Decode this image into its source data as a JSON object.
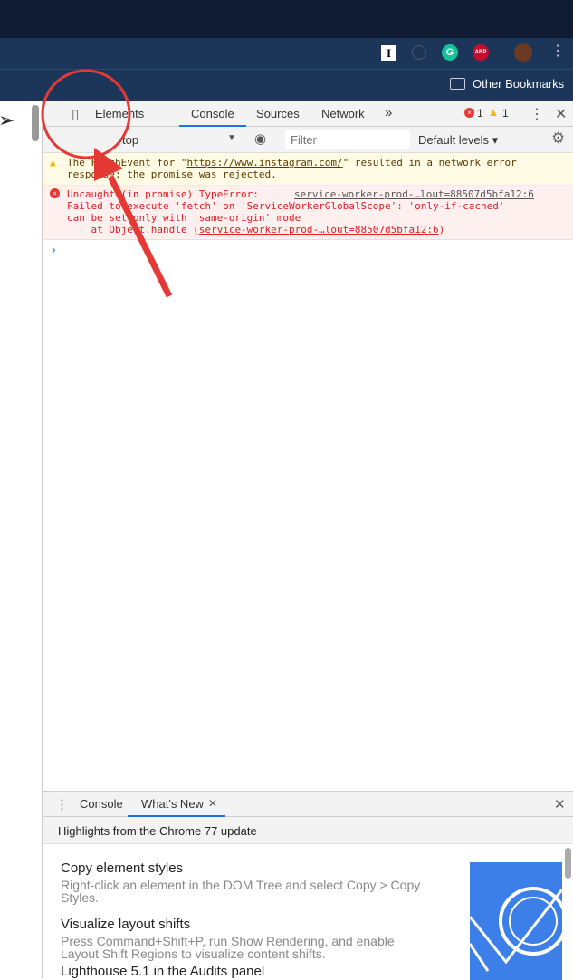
{
  "browser": {
    "bookmarks": {
      "other_label": "Other Bookmarks"
    },
    "extensions": [
      "instapaper-icon",
      "info-icon",
      "grammarly-icon",
      "adblock-plus-icon",
      "profile-avatar"
    ]
  },
  "devtools": {
    "tabs": [
      {
        "label": "Elements"
      },
      {
        "label": "Console",
        "active": true
      },
      {
        "label": "Sources"
      },
      {
        "label": "Network"
      }
    ],
    "more_tabs": "»",
    "error_count": "1",
    "warning_count": "1",
    "console_toolbar": {
      "context": "top",
      "filter_placeholder": "Filter",
      "levels": "Default levels ▾"
    },
    "messages": [
      {
        "type": "warning",
        "pre": "The FetchEvent for \"",
        "link": "https://www.instagram.com/",
        "post": "\" resulted in a network error",
        "line2": "response: the promise was rejected."
      },
      {
        "type": "error",
        "line1": "Uncaught (in promise) TypeError:",
        "source": "service-worker-prod-…lout=88507d5bfa12:6",
        "line2": "Failed to execute 'fetch' on 'ServiceWorkerGlobalScope': 'only-if-cached'",
        "line3": "can be set only with 'same-origin' mode",
        "line4_pre": "    at Object.handle (",
        "line4_link": "service-worker-prod-…lout=88507d5bfa12:6",
        "line4_post": ")"
      }
    ],
    "prompt": "›",
    "drawer": {
      "tabs": [
        {
          "label": "Console"
        },
        {
          "label": "What's New",
          "active": true,
          "closable": true
        }
      ],
      "highlights": "Highlights from the Chrome 77 update",
      "items": [
        {
          "title": "Copy element styles",
          "desc": "Right-click an element in the DOM Tree and select Copy > Copy Styles."
        },
        {
          "title": "Visualize layout shifts",
          "desc": "Press Command+Shift+P, run Show Rendering, and enable Layout Shift Regions to visualize content shifts."
        },
        {
          "title": "Lighthouse 5.1 in the Audits panel",
          "desc": ""
        }
      ]
    }
  },
  "annotation": {
    "color": "#e53935",
    "target": "toggle-device-toolbar"
  }
}
